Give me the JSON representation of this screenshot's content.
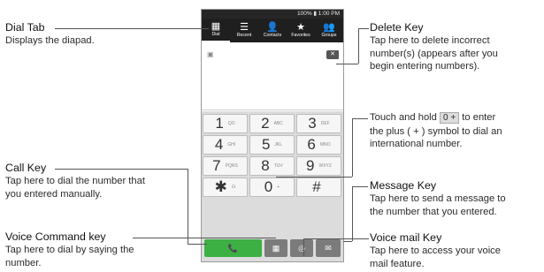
{
  "phone": {
    "status": "100% ▮ 1:00 PM",
    "tabs": [
      {
        "label": "Dial",
        "icon": "keypad-icon"
      },
      {
        "label": "Recent",
        "icon": "recent-icon"
      },
      {
        "label": "Contacts",
        "icon": "contacts-icon"
      },
      {
        "label": "Favorites",
        "icon": "favorites-icon"
      },
      {
        "label": "Groups",
        "icon": "groups-icon"
      }
    ],
    "keys": [
      {
        "digit": "1",
        "sub": "QO"
      },
      {
        "digit": "2",
        "sub": "ABC"
      },
      {
        "digit": "3",
        "sub": "DEF"
      },
      {
        "digit": "4",
        "sub": "GHI"
      },
      {
        "digit": "5",
        "sub": "JKL"
      },
      {
        "digit": "6",
        "sub": "MNO"
      },
      {
        "digit": "7",
        "sub": "PQRS"
      },
      {
        "digit": "8",
        "sub": "TUV"
      },
      {
        "digit": "9",
        "sub": "WXYZ"
      },
      {
        "digit": "✱",
        "sub": "☊"
      },
      {
        "digit": "0",
        "sub": "+"
      },
      {
        "digit": "#",
        "sub": ""
      }
    ],
    "colors": {
      "call": "#3cb043",
      "keypad_bg": "#dcdcdc",
      "tabs_bg": "#1f1f1f"
    }
  },
  "annotations": {
    "dial_tab": {
      "title": "Dial Tab",
      "desc": "Displays the diapad."
    },
    "call_key": {
      "title": "Call Key",
      "desc1": "Tap here to dial the number that",
      "desc2": "you entered manually."
    },
    "voice_command": {
      "title": "Voice Command key",
      "desc1": "Tap here to dial by saying the",
      "desc2": "number."
    },
    "delete_key": {
      "title": "Delete Key",
      "desc1": "Tap here to delete incorrect",
      "desc2": "number(s) (appears after you",
      "desc3": "begin entering numbers)."
    },
    "plus": {
      "line1_a": "Touch and hold",
      "line1_key": "0 +",
      "line1_b": "to enter",
      "line2": "the plus ( + ) symbol to dial an",
      "line3": "international number."
    },
    "message_key": {
      "title": "Message Key",
      "desc1": "Tap here to send a message to",
      "desc2": "the number that you entered."
    },
    "voicemail_key": {
      "title": "Voice mail Key",
      "desc1": "Tap here to access your voice",
      "desc2": "mail feature."
    }
  }
}
